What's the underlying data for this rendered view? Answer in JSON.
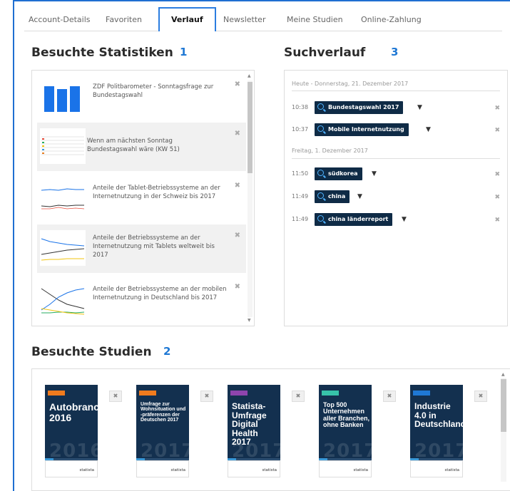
{
  "tabs": [
    {
      "label": "Account-Details"
    },
    {
      "label": "Favoriten"
    },
    {
      "label": "Verlauf"
    },
    {
      "label": "Newsletter"
    },
    {
      "label": "Meine Studien"
    },
    {
      "label": "Online-Zahlung"
    }
  ],
  "statistics": {
    "title": "Besuchte Statistiken",
    "number": "1",
    "items": [
      {
        "text": "ZDF Politbarometer - Sonntagsfrage zur Bundestagswahl",
        "thumb": "bar-chart"
      },
      {
        "text": "Wenn am nächsten Sonntag Bundestagswahl wäre (KW 51)",
        "thumb": "table"
      },
      {
        "text": "Anteile der Tablet-Betriebssysteme an der Internetnutzung in der Schweiz bis 2017",
        "thumb": "line-chart"
      },
      {
        "text": "Anteile der Betriebssysteme an der Internetnutzung mit Tablets weltweit bis 2017",
        "thumb": "line-chart"
      },
      {
        "text": "Anteile der Betriebssysteme an der mobilen Internetnutzung in Deutschland bis 2017",
        "thumb": "line-chart"
      }
    ],
    "close_symbol": "✖"
  },
  "history": {
    "title": "Suchverlauf",
    "number": "3",
    "groups": [
      {
        "date": "Heute - Donnerstag, 21. Dezember 2017",
        "entries": [
          {
            "time": "10:38",
            "query": "Bundestagswahl 2017"
          },
          {
            "time": "10:37",
            "query": "Mobile Internetnutzung"
          }
        ]
      },
      {
        "date": "Freitag, 1. Dezember 2017",
        "entries": [
          {
            "time": "11:50",
            "query": "südkorea"
          },
          {
            "time": "11:49",
            "query": "china"
          },
          {
            "time": "11:49",
            "query": "china länderreport"
          }
        ]
      }
    ],
    "filter_symbol": "▼",
    "close_symbol": "✖"
  },
  "studies": {
    "title": "Besuchte Studien",
    "number": "2",
    "items": [
      {
        "title": "Autobranche 2016",
        "year": "2016",
        "tag_color": "#f07b1e",
        "title_size": "14px"
      },
      {
        "title": "Umfrage zur Wohnsituation und -präferenzen der Deutschen 2017",
        "year": "2017",
        "tag_color": "#f07b1e",
        "title_size": "7px"
      },
      {
        "title": "Statista-Umfrage Digital Health 2017",
        "year": "2017",
        "tag_color": "#8e44ad",
        "title_size": "12px"
      },
      {
        "title": "Top 500 Unternehmen aller Branchen, ohne Banken",
        "year": "2017",
        "tag_color": "#37c2a9",
        "title_size": "9px"
      },
      {
        "title": "Industrie 4.0 in Deutschland",
        "year": "2017",
        "tag_color": "#1f78d4",
        "title_size": "12px"
      }
    ],
    "brand": "statista",
    "close_symbol": "✖"
  },
  "colors": {
    "accent": "#1f78d4",
    "chip_bg": "#0f2b46",
    "card_bg": "#13304f"
  }
}
